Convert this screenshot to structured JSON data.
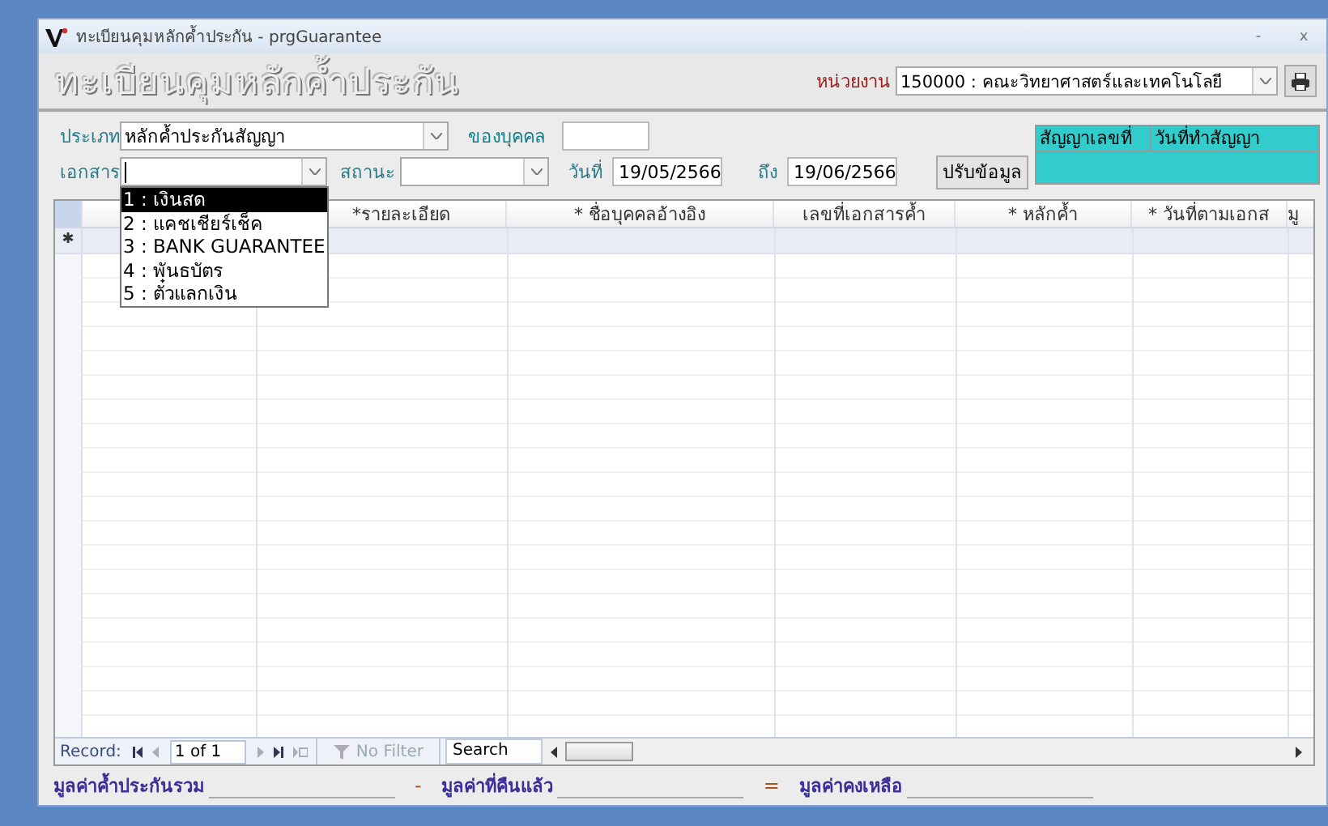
{
  "window": {
    "title": "ทะเบียนคุมหลักค้ำประกัน - prgGuarantee",
    "controls": [
      "-",
      "x"
    ]
  },
  "header": {
    "title": "ทะเบียนคุมหลักค้ำประกัน",
    "unit": {
      "label": "หน่วยงาน",
      "value": "150000 : คณะวิทยาศาสตร์และเทคโนโลยี"
    }
  },
  "filters": {
    "type": {
      "label": "ประเภท",
      "value": "หลักค้ำประกันสัญญา"
    },
    "person": {
      "label": "ของบุคคล"
    },
    "document": {
      "label": "เอกสาร"
    },
    "status": {
      "label": "สถานะ"
    },
    "date_from": {
      "label": "วันที่",
      "value": "19/05/2566"
    },
    "date_to": {
      "label": "ถึง",
      "value": "19/06/2566"
    },
    "refresh_button": "ปรับข้อมูล"
  },
  "contract_panel": {
    "columns": [
      "สัญญาเลขที่",
      "วันที่ทำสัญญา"
    ]
  },
  "document_dropdown": [
    {
      "label": "1 : เงินสด",
      "selected": true
    },
    {
      "label": "2 : แคชเชียร์เช็ค",
      "selected": false
    },
    {
      "label": "3 : BANK GUARANTEE",
      "selected": false
    },
    {
      "label": "4 : พันธบัตร",
      "selected": false
    },
    {
      "label": "5 : ตั๋วแลกเงิน",
      "selected": false
    }
  ],
  "table": {
    "columns": [
      "",
      "*รายละเอียด",
      "* ชื่อบุคคลอ้างอิง",
      "เลขที่เอกสารค้ำ",
      "* หลักค้ำ",
      "* วันที่ตามเอกส",
      "มู"
    ],
    "new_row_marker": "✱"
  },
  "navigation": {
    "record_label": "Record:",
    "position": "1 of 1",
    "filter": "No Filter",
    "search": "Search"
  },
  "totals": [
    {
      "label": "มูลค่าค้ำประกันรวม",
      "operator": "-"
    },
    {
      "label": "มูลค่าที่คืนแล้ว",
      "operator": "="
    },
    {
      "label": "มูลค่าคงเหลือ"
    }
  ]
}
